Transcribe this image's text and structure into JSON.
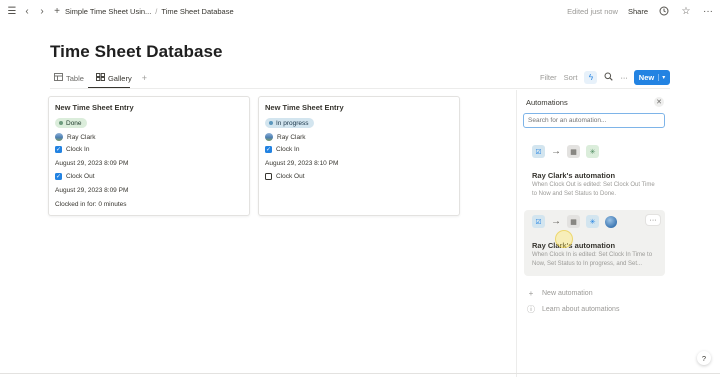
{
  "topbar": {
    "breadcrumbs": [
      "Simple Time Sheet Usin...",
      "Time Sheet Database"
    ],
    "edited": "Edited just now",
    "share": "Share",
    "icons": [
      "menu-icon",
      "back-icon",
      "forward-icon",
      "plus-icon",
      "clock-icon",
      "star-icon",
      "more-icon"
    ]
  },
  "page": {
    "title": "Time Sheet Database"
  },
  "views": {
    "tabs": [
      {
        "label": "Table",
        "icon": "table-icon",
        "active": false
      },
      {
        "label": "Gallery",
        "icon": "gallery-icon",
        "active": true
      }
    ],
    "tools": {
      "filter": "Filter",
      "sort": "Sort"
    },
    "new_button": "New"
  },
  "cards": [
    {
      "title": "New Time Sheet Entry",
      "status": "Done",
      "person": "Ray Clark",
      "clock_in_label": "Clock In",
      "clock_in_checked": true,
      "clock_in_time": "August 29, 2023 8:09 PM",
      "clock_out_label": "Clock Out",
      "clock_out_checked": true,
      "clock_out_time": "August 29, 2023 8:09 PM",
      "clocked_in_for": "Clocked in for: 0 minutes"
    },
    {
      "title": "New Time Sheet Entry",
      "status": "In progress",
      "person": "Ray Clark",
      "clock_in_label": "Clock In",
      "clock_in_checked": true,
      "clock_in_time": "August 29, 2023 8:10 PM",
      "clock_out_label": "Clock Out",
      "clock_out_checked": false
    }
  ],
  "automations": {
    "title": "Automations",
    "search_placeholder": "Search for an automation...",
    "items": [
      {
        "name": "Ray Clark's automation",
        "description": "When Clock Out is edited: Set Clock Out Time to Now and Set Status to Done."
      },
      {
        "name": "Ray Clark's automation",
        "description": "When Clock In is edited: Set Clock In Time to Now, Set Status to In progress, and Set..."
      }
    ],
    "new_automation": "New automation",
    "learn": "Learn about automations"
  },
  "help": "?"
}
